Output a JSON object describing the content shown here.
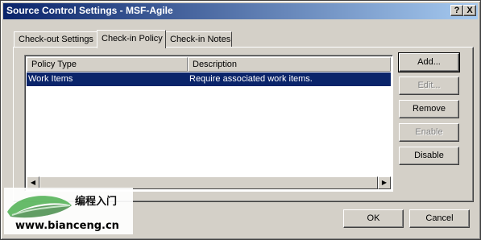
{
  "window": {
    "title": "Source Control Settings - MSF-Agile",
    "help_label": "?",
    "close_label": "X"
  },
  "tabs": [
    {
      "label": "Check-out Settings"
    },
    {
      "label": "Check-in Policy"
    },
    {
      "label": "Check-in Notes"
    }
  ],
  "policy_list": {
    "columns": [
      "Policy Type",
      "Description"
    ],
    "rows": [
      {
        "policy_type": "Work Items",
        "description": "Require associated work items."
      }
    ],
    "scroll_left_glyph": "◀",
    "scroll_right_glyph": "▶"
  },
  "side_buttons": {
    "add": "Add...",
    "edit": "Edit...",
    "remove": "Remove",
    "enable": "Enable",
    "disable": "Disable"
  },
  "footer_buttons": {
    "ok": "OK",
    "cancel": "Cancel"
  },
  "watermark": {
    "chinese_text": "编程入门",
    "url": "www.bianceng.cn"
  },
  "colors": {
    "title_gradient_start": "#0a246a",
    "title_gradient_end": "#a6caf0",
    "selection": "#0a246a",
    "face": "#d4d0c8"
  }
}
